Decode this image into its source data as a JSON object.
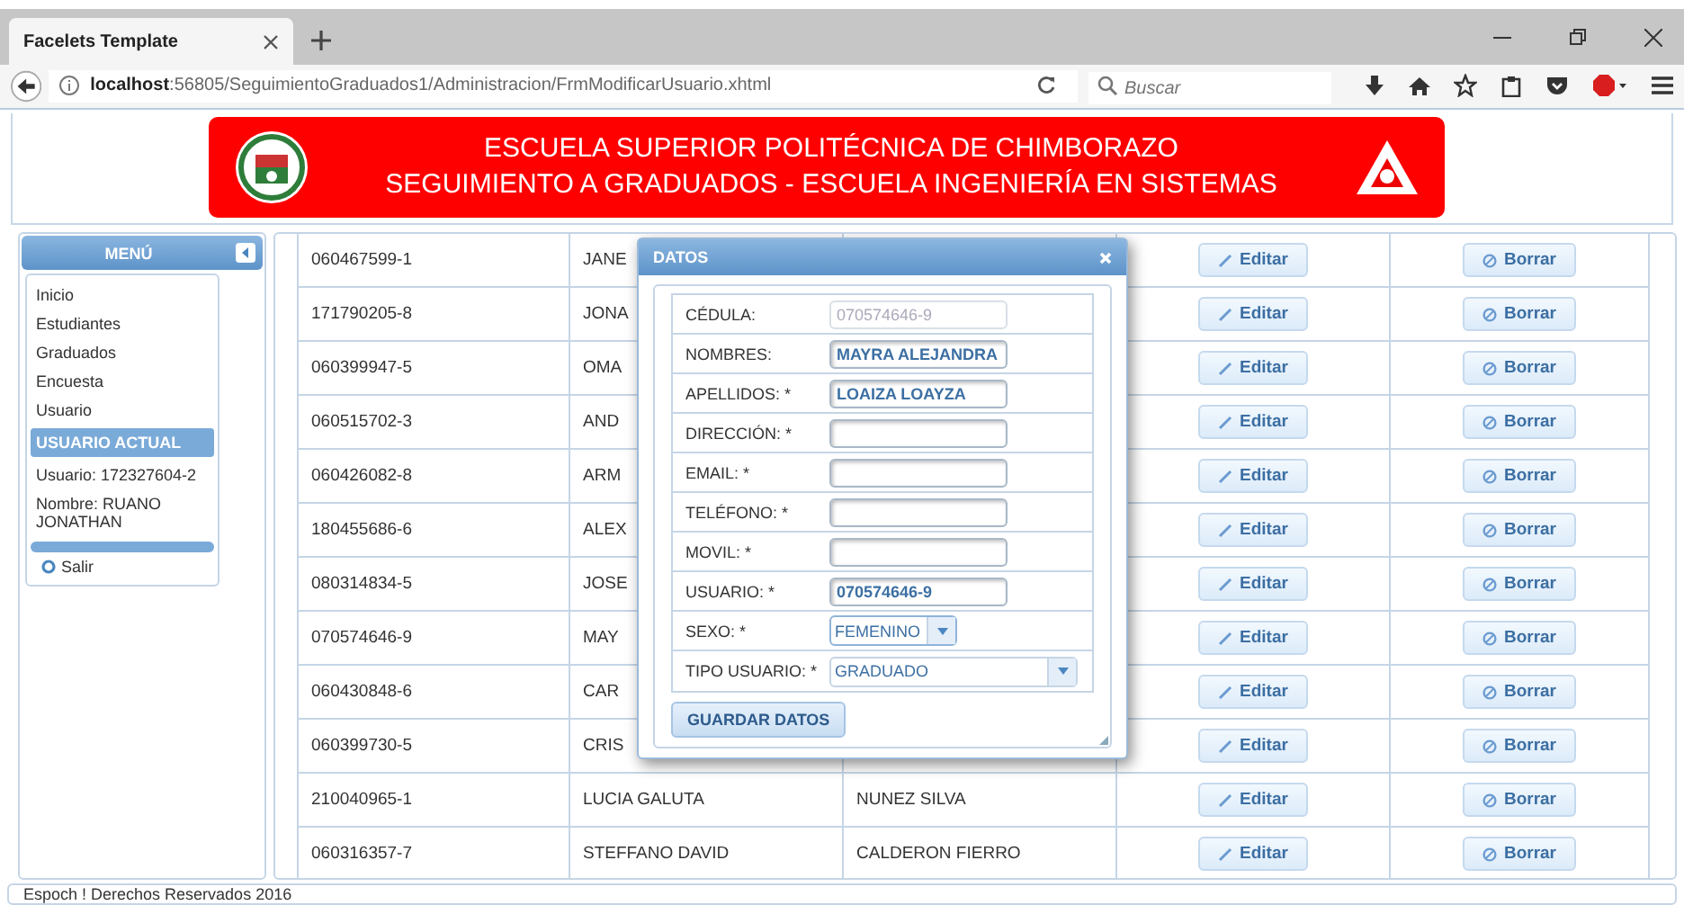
{
  "browser": {
    "tab_title": "Facelets Template",
    "url_host": "localhost",
    "url_rest": ":56805/SeguimientoGraduados1/Administracion/FrmModificarUsuario.xhtml",
    "search_placeholder": "Buscar"
  },
  "header": {
    "line_1": "ESCUELA SUPERIOR POLITÉCNICA DE CHIMBORAZO",
    "line_2": "SEGUIMIENTO A GRADUADOS - ESCUELA INGENIERÍA EN SISTEMAS"
  },
  "sidebar": {
    "title": "MENÚ",
    "items": [
      "Inicio",
      "Estudiantes",
      "Graduados",
      "Encuesta",
      "Usuario"
    ],
    "section": "USUARIO ACTUAL",
    "user": "Usuario: 172327604-2",
    "name": "Nombre: RUANO JONATHAN",
    "logout": "Salir"
  },
  "table": {
    "rows": [
      {
        "cedula": "060467599-1",
        "nombres": "JANE",
        "edit": "Editar",
        "delete": "Borrar"
      },
      {
        "cedula": "171790205-8",
        "nombres": "JONA",
        "edit": "Editar",
        "delete": "Borrar"
      },
      {
        "cedula": "060399947-5",
        "nombres": "OMA",
        "edit": "Editar",
        "delete": "Borrar"
      },
      {
        "cedula": "060515702-3",
        "nombres": "AND",
        "edit": "Editar",
        "delete": "Borrar"
      },
      {
        "cedula": "060426082-8",
        "nombres": "ARM",
        "edit": "Editar",
        "delete": "Borrar"
      },
      {
        "cedula": "180455686-6",
        "nombres": "ALEX",
        "edit": "Editar",
        "delete": "Borrar"
      },
      {
        "cedula": "080314834-5",
        "nombres": "JOSE",
        "edit": "Editar",
        "delete": "Borrar"
      },
      {
        "cedula": "070574646-9",
        "nombres": "MAY",
        "edit": "Editar",
        "delete": "Borrar"
      },
      {
        "cedula": "060430848-6",
        "nombres": "CAR",
        "edit": "Editar",
        "delete": "Borrar"
      },
      {
        "cedula": "060399730-5",
        "nombres": "CRIS",
        "edit": "Editar",
        "delete": "Borrar"
      },
      {
        "cedula": "210040965-1",
        "nombres": "LUCIA GALUTA",
        "apellidos": "NUNEZ SILVA",
        "edit": "Editar",
        "delete": "Borrar"
      },
      {
        "cedula": "060316357-7",
        "nombres": "STEFFANO DAVID",
        "apellidos": "CALDERON FIERRO",
        "edit": "Editar",
        "delete": "Borrar"
      }
    ]
  },
  "dialog": {
    "title": "DATOS",
    "fields": [
      {
        "kind": "text",
        "label": "CÉDULA:",
        "value": "070574646-9",
        "disabled": true
      },
      {
        "kind": "text",
        "label": "NOMBRES:",
        "value": "MAYRA ALEJANDRA",
        "disabled": false
      },
      {
        "kind": "text",
        "label": "APELLIDOS: *",
        "value": "LOAIZA LOAYZA",
        "disabled": false
      },
      {
        "kind": "text",
        "label": "DIRECCIÓN: *",
        "disabled": false
      },
      {
        "kind": "text",
        "label": "EMAIL: *",
        "disabled": false
      },
      {
        "kind": "text",
        "label": "TELÉFONO: *",
        "disabled": false
      },
      {
        "kind": "text",
        "label": "MOVIL: *",
        "disabled": false
      },
      {
        "kind": "text",
        "label": "USUARIO: *",
        "value": "070574646-9",
        "disabled": false
      },
      {
        "kind": "select",
        "label": "SEXO: *",
        "value": "FEMENINO",
        "wide": false
      },
      {
        "kind": "select",
        "label": "TIPO USUARIO: *",
        "value": "GRADUADO",
        "wide": true
      }
    ],
    "button": "GUARDAR DATOS"
  },
  "footer": "Espoch ! Derechos Reservados 2016"
}
